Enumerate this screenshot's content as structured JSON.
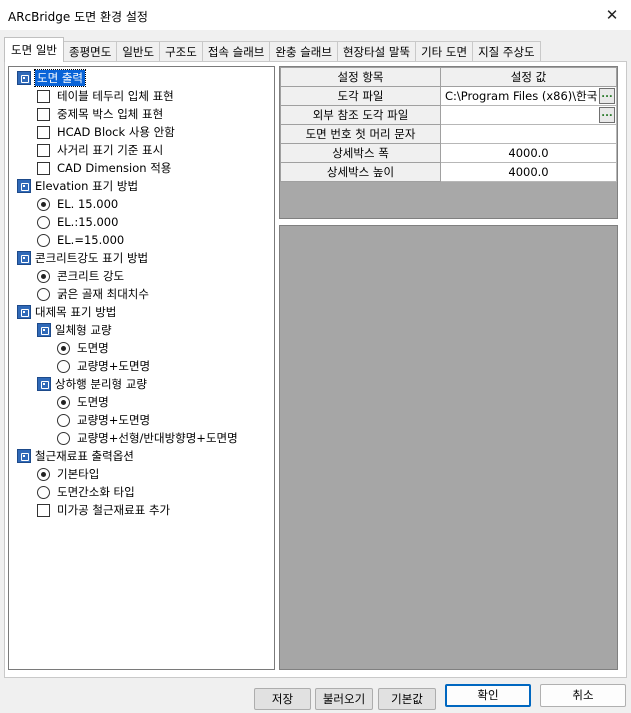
{
  "window": {
    "title": "ARcBridge 도면 환경 설정"
  },
  "tabs": [
    "도면 일반",
    "종평면도",
    "일반도",
    "구조도",
    "접속 슬래브",
    "완충 슬래브",
    "현장타설 말뚝",
    "기타 도면",
    "지질 주상도"
  ],
  "tree": {
    "drawing_output": {
      "label": "도면 출력",
      "items": [
        "테이블 테두리 입체 표현",
        "중제목 박스 입체 표현",
        "HCAD Block 사용 안함",
        "사거리 표기 기준 표시",
        "CAD Dimension 적용"
      ]
    },
    "elevation": {
      "label": "Elevation 표기 방법",
      "items": [
        "EL. 15.000",
        "EL.:15.000",
        "EL.=15.000"
      ],
      "selected": "EL. 15.000"
    },
    "concrete": {
      "label": "콘크리트강도 표기 방법",
      "items": [
        "콘크리트 강도",
        "굵은 골재 최대치수"
      ],
      "selected": "콘크리트 강도"
    },
    "title_method": {
      "label": "대제목 표기 방법",
      "integral": {
        "label": "일체형 교량",
        "items": [
          "도면명",
          "교량명+도면명"
        ],
        "selected": "도면명"
      },
      "separate": {
        "label": "상하행 분리형 교량",
        "items": [
          "도면명",
          "교량명+도면명",
          "교량명+선형/반대방향명+도면명"
        ],
        "selected": "도면명"
      }
    },
    "rebar_table": {
      "label": "철근재료표 출력옵션",
      "items": [
        "기본타입",
        "도면간소화 타입"
      ],
      "selected": "기본타입",
      "checkbox": "미가공 철근재료표 추가"
    }
  },
  "grid": {
    "headers": [
      "설정 항목",
      "설정 값"
    ],
    "rows": [
      {
        "label": "도각 파일",
        "value": "C:\\Program Files (x86)\\한국",
        "has_button": true
      },
      {
        "label": "외부 참조 도각 파일",
        "value": "",
        "has_button": true
      },
      {
        "label": "도면 번호 첫 머리 문자",
        "value": "",
        "has_button": false
      },
      {
        "label": "상세박스 폭",
        "value": "4000.0",
        "has_button": false
      },
      {
        "label": "상세박스 높이",
        "value": "4000.0",
        "has_button": false
      }
    ],
    "ellipsis": "..."
  },
  "buttons": {
    "save": "저장",
    "load": "불러오기",
    "default": "기본값",
    "ok": "확인",
    "cancel": "취소"
  },
  "colors": {
    "selection": "#0a64d8",
    "icon": "#2f69b8",
    "ok_border": "#0067c0"
  }
}
